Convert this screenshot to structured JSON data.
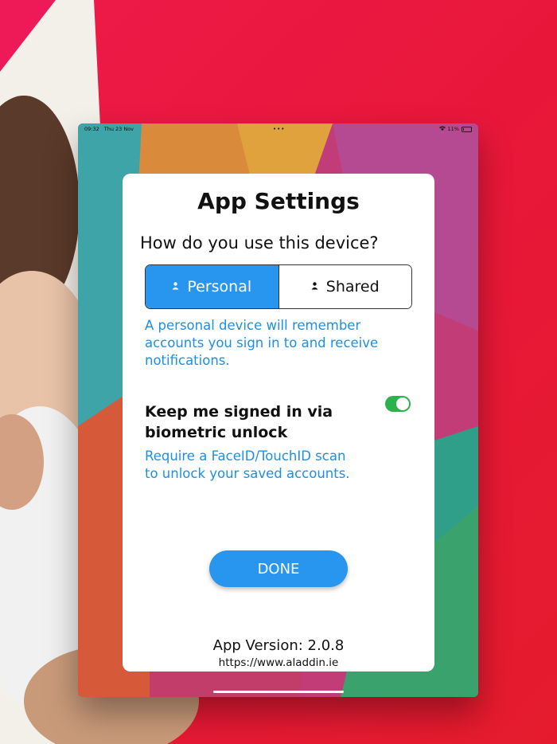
{
  "status_bar": {
    "time": "09:32",
    "date": "Thu 23 Nov",
    "dots": "•••",
    "battery": "11%",
    "wifi_icon": "wifi-icon",
    "battery_icon": "battery-icon"
  },
  "modal": {
    "title": "App Settings",
    "question": "How do you use this device?",
    "segments": [
      {
        "label": "Personal",
        "icon": "person-icon",
        "selected": true
      },
      {
        "label": "Shared",
        "icon": "person-icon",
        "selected": false
      }
    ],
    "segment_description": "A personal device will remember accounts you sign in to and receive notifications.",
    "biometric": {
      "label": "Keep me signed in via biometric unlock",
      "description": "Require a FaceID/TouchID scan to unlock your saved accounts.",
      "enabled": true
    },
    "done_label": "DONE",
    "version": "App Version: 2.0.8",
    "url": "https://www.aladdin.ie"
  },
  "colors": {
    "accent": "#2896ef",
    "link_text": "#1e8fe6",
    "toggle_on": "#2bb24c",
    "background_red": "#e8173a"
  }
}
